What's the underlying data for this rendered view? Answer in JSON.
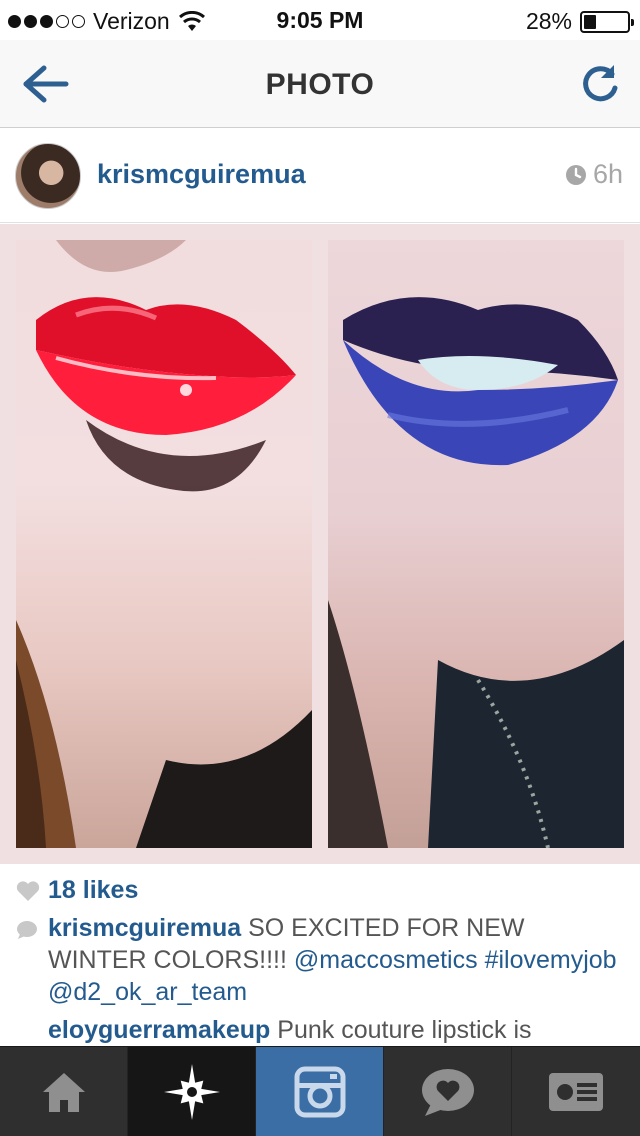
{
  "status_bar": {
    "carrier": "Verizon",
    "time": "9:05 PM",
    "battery_percent": "28%",
    "battery_level": 0.28
  },
  "nav": {
    "title": "PHOTO"
  },
  "post": {
    "username": "krismcguiremua",
    "time_ago": "6h",
    "likes": "18 likes",
    "comments": [
      {
        "user": "krismcguiremua",
        "text": "SO EXCITED FOR NEW WINTER COLORS!!!!",
        "mentions": [
          "@maccosmetics",
          "#ilovemyjob",
          "@d2_ok_ar_team"
        ]
      },
      {
        "user": "eloyguerramakeup",
        "text": "Punk couture lipstick is"
      }
    ]
  },
  "tab_bar": {
    "items": [
      {
        "icon": "home-icon"
      },
      {
        "icon": "explore-star-icon"
      },
      {
        "icon": "camera-icon"
      },
      {
        "icon": "activity-heart-icon"
      },
      {
        "icon": "profile-card-icon"
      }
    ]
  },
  "colors": {
    "link_blue": "#245b8f",
    "camera_tab": "#3a6ea5",
    "tab_bar": "#2f2f2f"
  }
}
